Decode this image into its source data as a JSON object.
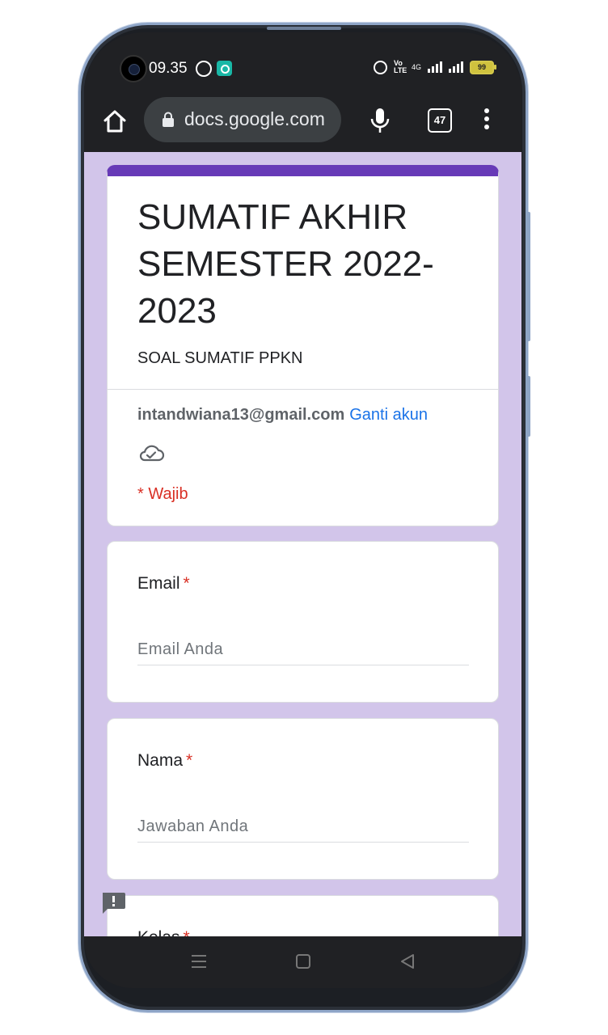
{
  "status_bar": {
    "time": "09.35",
    "network_type": "4G",
    "volte_label": "Vo LTE",
    "battery_level": "99"
  },
  "browser": {
    "url": "docs.google.com",
    "tab_count": "47"
  },
  "form": {
    "title": "SUMATIF AKHIR SEMESTER 2022-2023",
    "description": "SOAL SUMATIF PPKN",
    "account_email": "intandwiana13@gmail.com",
    "switch_account_label": "Ganti akun",
    "required_note": "* Wajib",
    "accent_color": "#673ab7",
    "background_color": "#d2c5ea",
    "questions": [
      {
        "label": "Email",
        "required_mark": "*",
        "placeholder": "Email Anda"
      },
      {
        "label": "Nama",
        "required_mark": "*",
        "placeholder": "Jawaban Anda"
      },
      {
        "label": "Kelas",
        "required_mark": "*"
      }
    ]
  },
  "icons": {
    "home": "home-icon",
    "lock": "lock-icon",
    "mic": "mic-icon",
    "menu": "more-vert-icon",
    "cloud": "cloud-saved-icon",
    "feedback": "feedback-icon"
  }
}
